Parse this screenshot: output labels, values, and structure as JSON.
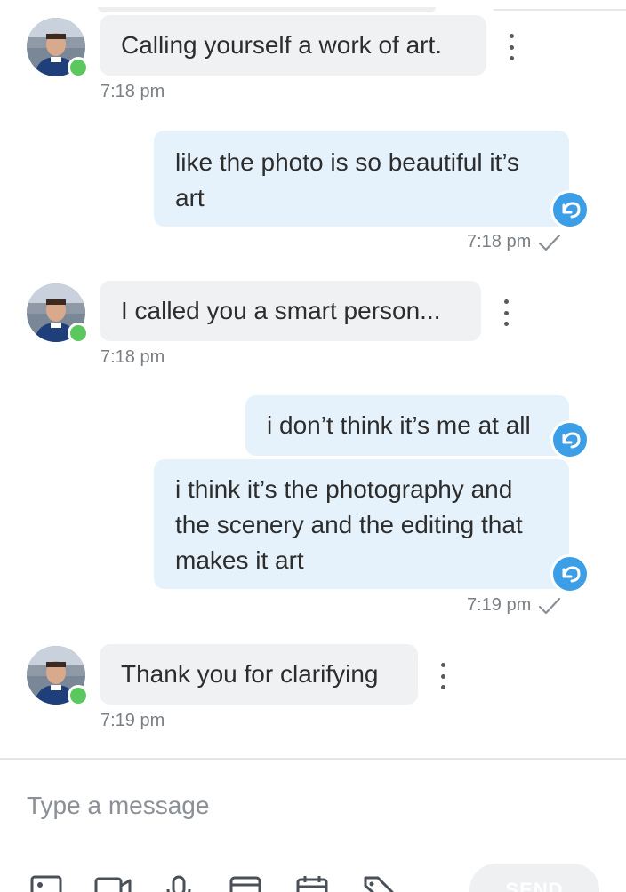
{
  "messages": [
    {
      "direction": "in",
      "text": "Calling yourself a work of art.",
      "time": "7:18 pm"
    },
    {
      "direction": "out",
      "text": "like the photo is so beautiful it’s art",
      "time": "7:18 pm"
    },
    {
      "direction": "in",
      "text": "I called you a smart person...",
      "time": "7:18 pm"
    },
    {
      "direction": "out",
      "text": "i don’t think it’s me at all",
      "time": ""
    },
    {
      "direction": "out",
      "text": "i think it’s the photography and the scenery and the editing that makes it art",
      "time": "7:19 pm"
    },
    {
      "direction": "in",
      "text": "Thank you for clarifying",
      "time": "7:19 pm"
    }
  ],
  "composer": {
    "placeholder": "Type a message",
    "send_label": "SEND",
    "tools": [
      "image-icon",
      "video-icon",
      "microphone-icon",
      "card-icon",
      "calendar-icon",
      "tag-icon"
    ]
  },
  "colors": {
    "incoming_bubble": "#f0f1f3",
    "outgoing_bubble": "#e5f2fb",
    "online": "#5ac85f",
    "reply_badge": "#3d9ee8"
  },
  "icons": {
    "read_receipt": "checkmark-icon",
    "reply": "reply-icon",
    "more": "more-vertical-icon"
  }
}
